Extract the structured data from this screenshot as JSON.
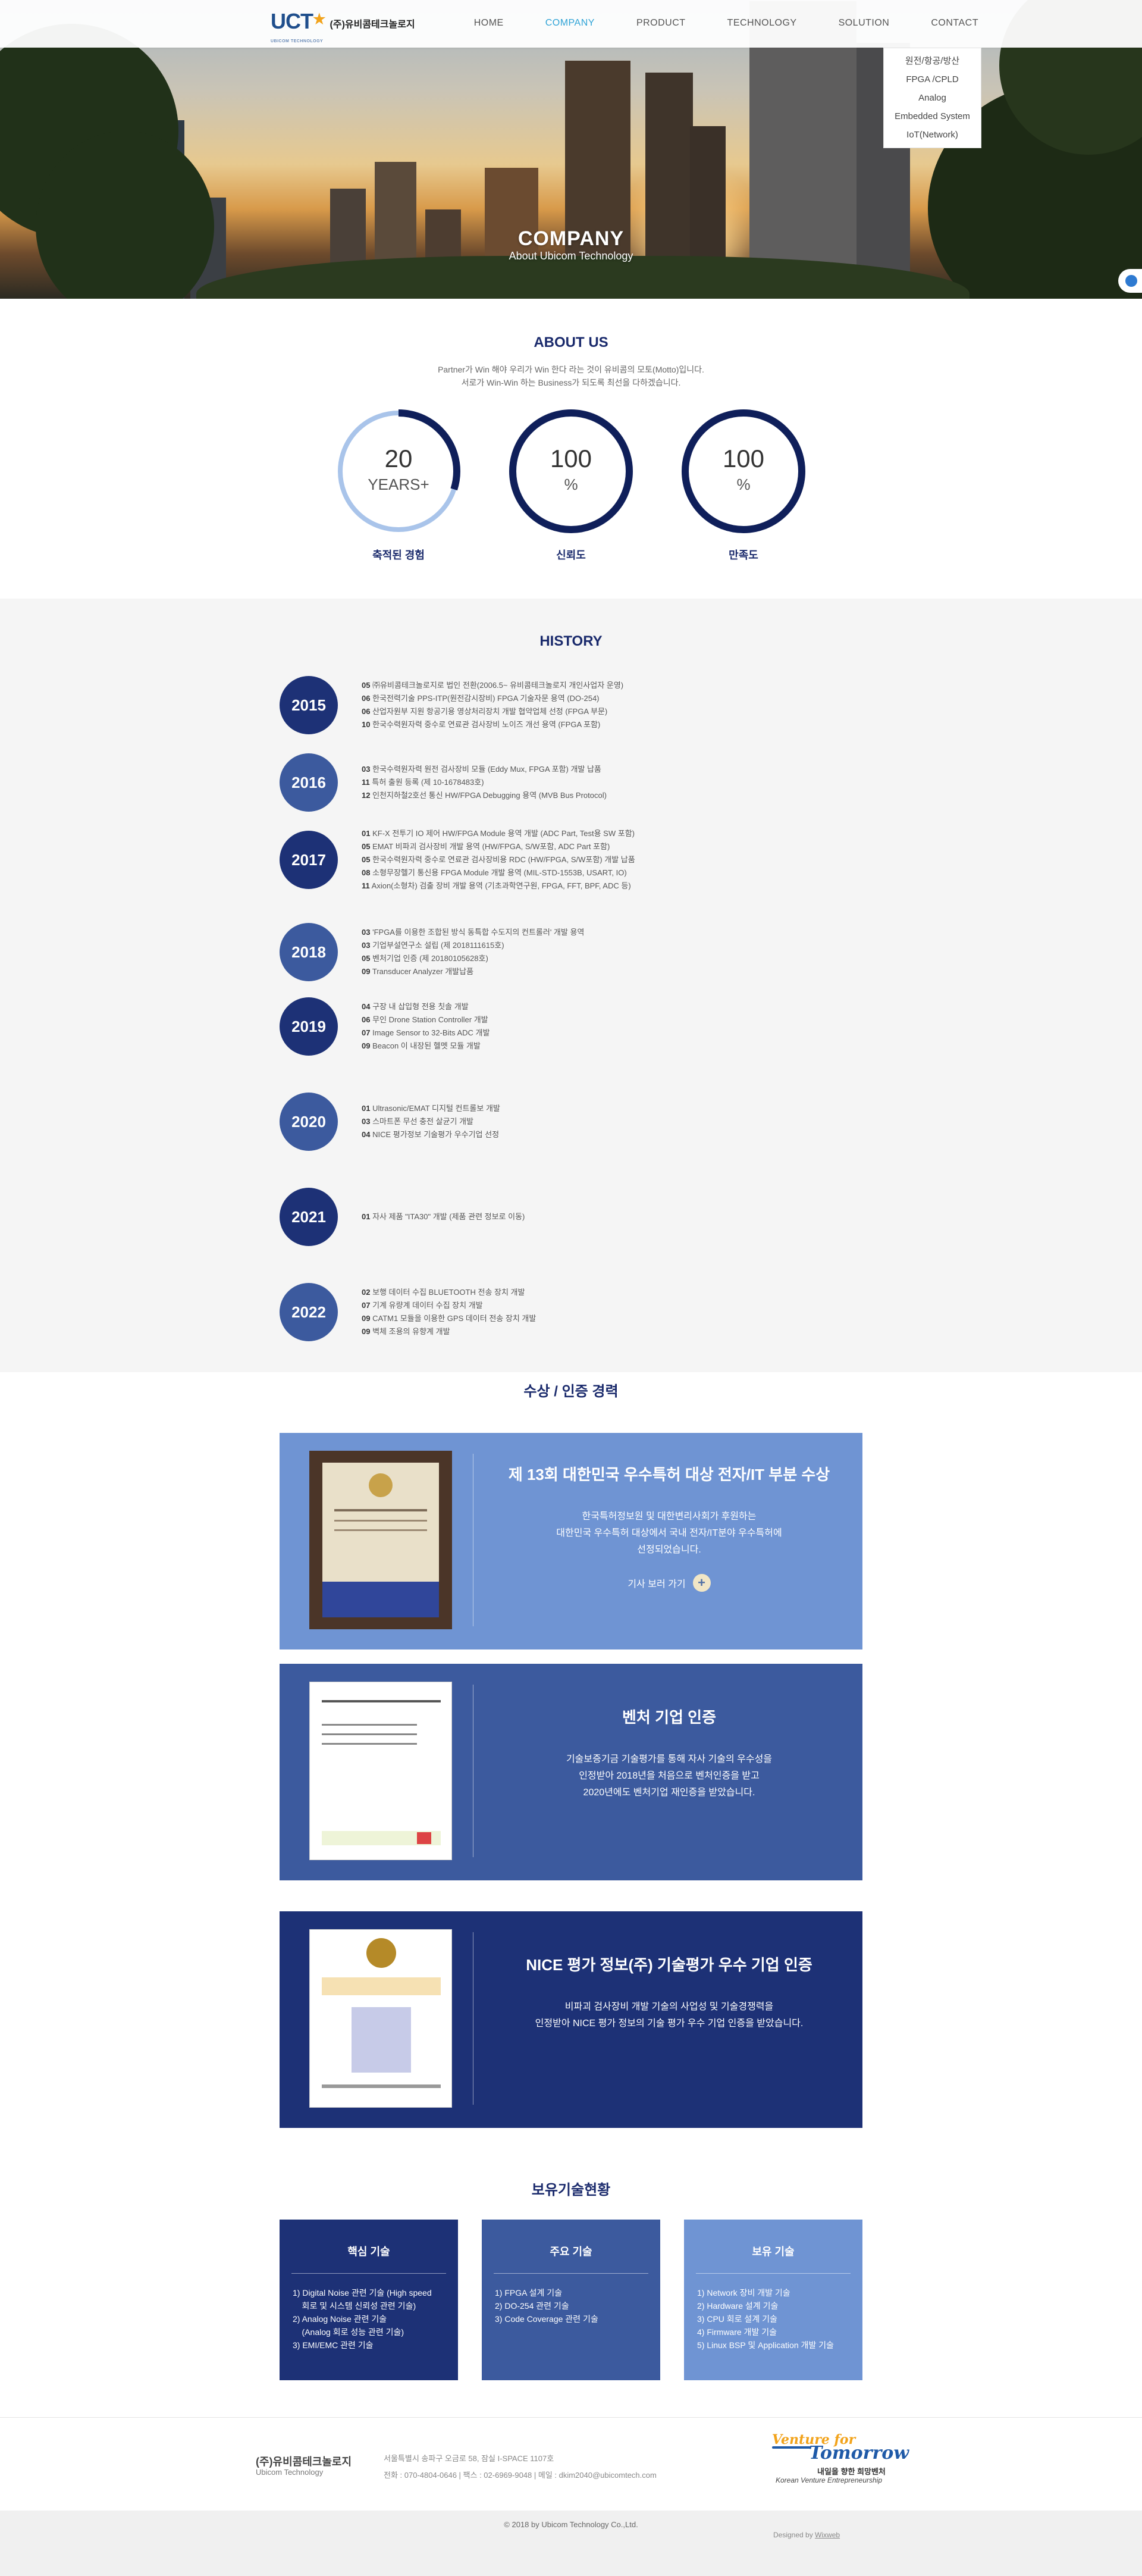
{
  "header": {
    "logo_mark": "UCT",
    "logo_sub": "UBICOM TECHNOLOGY",
    "logo_name": "(주)유비콤테크놀로지",
    "nav": [
      "HOME",
      "COMPANY",
      "PRODUCT",
      "TECHNOLOGY",
      "SOLUTION",
      "CONTACT"
    ],
    "active_nav": "COMPANY"
  },
  "solution_dropdown": [
    "원전/항공/방산",
    "FPGA /CPLD",
    "Analog",
    "Embedded System",
    "IoT(Network)"
  ],
  "hero": {
    "title": "COMPANY",
    "subtitle": "About Ubicom Technology"
  },
  "about": {
    "title": "ABOUT US",
    "desc_line1": "Partner가 Win 해야 우리가 Win 한다 라는 것이 유비콤의 모토(Motto)입니다.",
    "desc_line2": "서로가 Win-Win 하는 Business가 되도록 최선을 다하겠습니다.",
    "stats": [
      {
        "number": "20",
        "unit": "YEARS+",
        "label": "축적된 경험",
        "progress": 0.3
      },
      {
        "number": "100",
        "unit": "%",
        "label": "신뢰도",
        "progress": 1.0
      },
      {
        "number": "100",
        "unit": "%",
        "label": "만족도",
        "progress": 1.0
      }
    ]
  },
  "history": {
    "title": "HISTORY",
    "years": [
      {
        "year": "2015",
        "items": [
          [
            "05",
            "㈜유비콤테크놀로지로 법인 전환(2006.5~ 유비콤테크놀로지 개인사업자 운영)"
          ],
          [
            "06",
            "한국전력기술 PPS-ITP(원전감시장비) FPGA 기술자문 용역 (DO-254)"
          ],
          [
            "06",
            "산업자원부 지원 항공기용 영상처리장치 개발 협약업체 선정 (FPGA 부문)"
          ],
          [
            "10",
            "한국수력원자력 중수로 연료관 검사장비 노이즈 개선 용역 (FPGA 포함)"
          ]
        ]
      },
      {
        "year": "2016",
        "items": [
          [
            "03",
            "한국수력원자력 원전 검사장비 모듈 (Eddy Mux, FPGA 포함) 개발 납품"
          ],
          [
            "11",
            "특허 출원 등록 (제 10-1678483호)"
          ],
          [
            "12",
            "인천지하철2호선 통신 HW/FPGA Debugging 용역 (MVB Bus Protocol)"
          ]
        ]
      },
      {
        "year": "2017",
        "items": [
          [
            "01",
            "KF-X 전투기 IO 제어 HW/FPGA Module 용역 개발 (ADC Part, Test용 SW 포함)"
          ],
          [
            "05",
            "EMAT 비파괴 검사장비 개발 용역 (HW/FPGA, S/W포함, ADC Part 포함)"
          ],
          [
            "05",
            "한국수력원자력 중수로 연료관 검사장비용 RDC (HW/FPGA, S/W포함) 개발 납품"
          ],
          [
            "08",
            "소형무장헬기 통신용 FPGA Module 개발 용역 (MIL-STD-1553B, USART, IO)"
          ],
          [
            "11",
            "Axion(소형차) 검출 장비 개발 용역 (기초과학연구원, FPGA, FFT, BPF, ADC 등)"
          ]
        ]
      },
      {
        "year": "2018",
        "items": [
          [
            "03",
            "'FPGA를 이용한 조합된 방식 동특합 수도지의 컨트롤러' 개발 용역"
          ],
          [
            "03",
            "기업부설연구소 설립 (제 2018111615호)"
          ],
          [
            "05",
            "벤처기업 인증 (제 20180105628호)"
          ],
          [
            "09",
            "Transducer Analyzer 개발납품"
          ]
        ]
      },
      {
        "year": "2019",
        "items": [
          [
            "04",
            "구장 내 삽입형 전용 칫솔 개발"
          ],
          [
            "06",
            "무인 Drone Station Controller 개발"
          ],
          [
            "07",
            "Image Sensor to 32-Bits ADC 개발"
          ],
          [
            "09",
            "Beacon 이 내장된 헬멧 모듈 개발"
          ]
        ]
      },
      {
        "year": "2020",
        "items": [
          [
            "01",
            "Ultrasonic/EMAT 디지털 컨트롤보 개발"
          ],
          [
            "03",
            "스마트폰 무선 충전 살균기 개발"
          ],
          [
            "04",
            "NICE 평가정보 기술평가 우수기업 선정"
          ]
        ]
      },
      {
        "year": "2021",
        "items": [
          [
            "01",
            "자사 제품 \"ITA30\" 개발 (제품 관련 정보로 이동)"
          ]
        ]
      },
      {
        "year": "2022",
        "items": [
          [
            "02",
            "보행 데이터 수집 BLUETOOTH 전송 장치 개발"
          ],
          [
            "07",
            "기계 유량계 데이터 수집 장치 개발"
          ],
          [
            "09",
            "CATM1 모듈을 이용한 GPS 데이터 전송 장치 개발"
          ],
          [
            "09",
            "벽체 조용의 유향계 개발"
          ]
        ]
      }
    ]
  },
  "awards": {
    "title": "수상 / 인증 경력",
    "cards": [
      {
        "title": "제 13회 대한민국 우수특허 대상 전자/IT 부분 수상",
        "lines": [
          "한국특허정보원 및 대한변리사회가 후원하는",
          "대한민국 우수특허 대상에서 국내 전자/IT분야 우수특허에",
          "선정되었습니다."
        ],
        "link": "기사 보러 가기",
        "color": "#6f94d3"
      },
      {
        "title": "벤처 기업 인증",
        "lines": [
          "기술보증기금 기술평가를 통해 자사 기술의 우수성을",
          "인정받아 2018년을 처음으로 벤처인증을 받고",
          "2020년에도 벤처기업 재인증을 받았습니다."
        ],
        "color": "#3c5a9e"
      },
      {
        "title": "NICE 평가 정보(주) 기술평가 우수 기업 인증",
        "lines": [
          "비파괴 검사장비 개발 기술의 사업성 및 기술경쟁력을",
          "인정받아 NICE 평가 정보의 기술 평가 우수 기업 인증을 받았습니다."
        ],
        "color": "#1d3176"
      }
    ]
  },
  "tech": {
    "title": "보유기술현황",
    "boxes": [
      {
        "head": "핵심 기술",
        "color": "#1d3176",
        "items": [
          "1) Digital Noise 관련 기술 (High speed",
          "    회로 및 시스템 신뢰성 관련 기술)",
          "2) Analog Noise 관련 기술",
          "    (Analog 회로 성능 관련 기술)",
          "3) EMI/EMC 관련 기술"
        ]
      },
      {
        "head": "주요 기술",
        "color": "#3c5a9e",
        "items": [
          "1) FPGA 설계 기술",
          "2) DO-254 관련 기술",
          "3) Code Coverage 관련 기술"
        ]
      },
      {
        "head": "보유 기술",
        "color": "#6f94d3",
        "items": [
          "1) Network 장비 개발 기술",
          "2) Hardware 설계 기술",
          "3) CPU 회로 설계 기술",
          "4) Firmware 개발 기술",
          "5) Linux BSP 및 Application 개발 기술"
        ]
      }
    ]
  },
  "footer": {
    "company": "(주)유비콤테크놀로지",
    "company_en": "Ubicom Technology",
    "address": "서울특별시 송파구 오금로 58, 잠실 I-SPACE 1107호",
    "contact": "전화 : 070-4804-0646  |  팩스 : 02-6969-9048  |  메일 : dkim2040@ubicomtech.com",
    "vt_line1": "Venture for",
    "vt_line2": "Tomorrow",
    "vt_ko": "내일을 향한 희망벤처",
    "vt_en": "Korean Venture Entrepreneurship",
    "copyright": "© 2018 by Ubicom Technology Co.,Ltd.",
    "designed_prefix": "Designed by ",
    "designed_by": "Wixweb"
  }
}
